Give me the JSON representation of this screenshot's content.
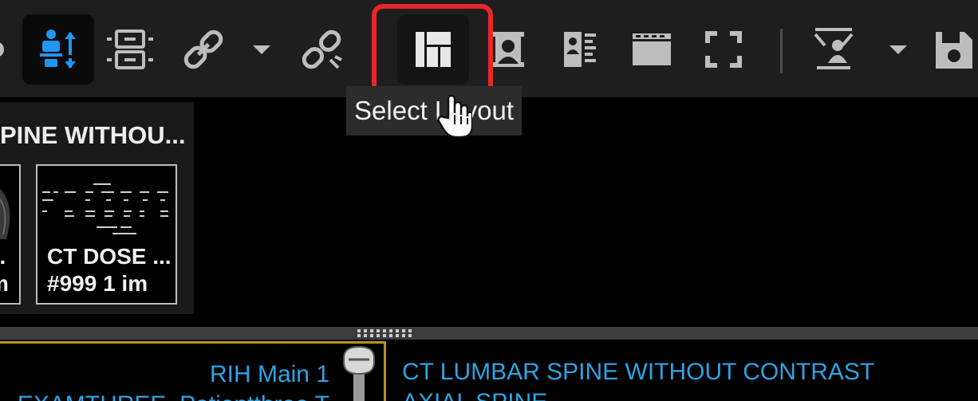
{
  "toolbar": {
    "buttons": [
      {
        "name": "circle-tool",
        "icon": "partial-circle-icon"
      },
      {
        "name": "stack-sync",
        "icon": "person-sync-icon",
        "state": "active"
      },
      {
        "name": "stack-series",
        "icon": "stack-layers-icon"
      },
      {
        "name": "link",
        "icon": "link-icon"
      },
      {
        "name": "link-options",
        "icon": "caret-down-icon"
      },
      {
        "name": "unlink",
        "icon": "unlink-icon"
      },
      {
        "name": "select-layout",
        "icon": "layout-grid-icon",
        "state": "highlighted"
      },
      {
        "name": "patient-info",
        "icon": "portrait-icon"
      },
      {
        "name": "report",
        "icon": "report-icon"
      },
      {
        "name": "window-view",
        "icon": "window-icon"
      },
      {
        "name": "fullscreen",
        "icon": "fullscreen-icon"
      },
      {
        "name": "presets",
        "icon": "person-tool-icon"
      },
      {
        "name": "presets-options",
        "icon": "caret-down-icon"
      },
      {
        "name": "save",
        "icon": "save-icon"
      }
    ],
    "icon_color": "#bdbdbd",
    "active_color": "#2196f3",
    "highlight_color": "#e8262a"
  },
  "tooltip": {
    "text": "Select Layout"
  },
  "series_panel": {
    "title": "PINE WITHOU...",
    "thumbnails": [
      {
        "line1": "...",
        "line2": "m"
      },
      {
        "line1": "CT DOSE ...",
        "line2": "#999    1 im"
      }
    ]
  },
  "viewports": {
    "left": {
      "line1": "RIH Main 1",
      "line2": "EXAMTHREE, Patientthree T"
    },
    "right": {
      "line1": "CT LUMBAR SPINE WITHOUT CONTRAST",
      "line2": "AXIAL SPINE"
    }
  }
}
